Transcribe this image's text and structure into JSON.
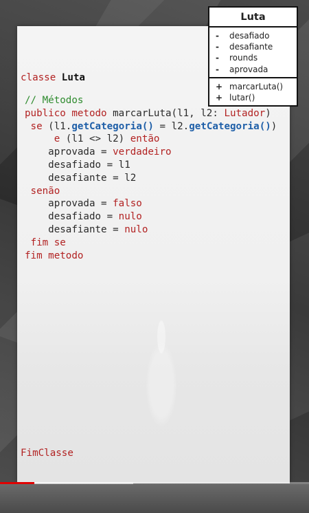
{
  "uml": {
    "title": "Luta",
    "attributes": [
      {
        "symbol": "-",
        "name": "desafiado"
      },
      {
        "symbol": "-",
        "name": "desafiante"
      },
      {
        "symbol": "-",
        "name": "rounds"
      },
      {
        "symbol": "-",
        "name": "aprovada"
      }
    ],
    "methods": [
      {
        "symbol": "+",
        "name": "marcarLuta()"
      },
      {
        "symbol": "+",
        "name": "lutar()"
      }
    ]
  },
  "code": {
    "class_kw": "classe ",
    "class_name": "Luta",
    "comment": "// Métodos",
    "l1_kw": "publico metodo",
    "l1_rest": " marcarLuta(l1, l2: ",
    "l1_type": "Lutador",
    "l1_end": ")",
    "l2_kw": "se",
    "l2_a": " (l1.",
    "l2_fn1": "getCategoria()",
    "l2_b": " = l2.",
    "l2_fn2": "getCategoria()",
    "l2_c": ")",
    "l3_kw1": "e",
    "l3_mid": " (l1 <> l2) ",
    "l3_kw2": "então",
    "l4_a": "aprovada = ",
    "l4_val": "verdadeiro",
    "l5": "desafiado = l1",
    "l6": "desafiante = l2",
    "l7": "senão",
    "l8_a": "aprovada = ",
    "l8_val": "falso",
    "l9_a": "desafiado = ",
    "l9_val": "nulo",
    "l10_a": "desafiante = ",
    "l10_val": "nulo",
    "l11": "fim se",
    "l12": "fim metodo",
    "end_class": "FimClasse"
  },
  "player": {
    "progress": 0.11,
    "buffered": 0.43,
    "accent": "#e00000"
  }
}
